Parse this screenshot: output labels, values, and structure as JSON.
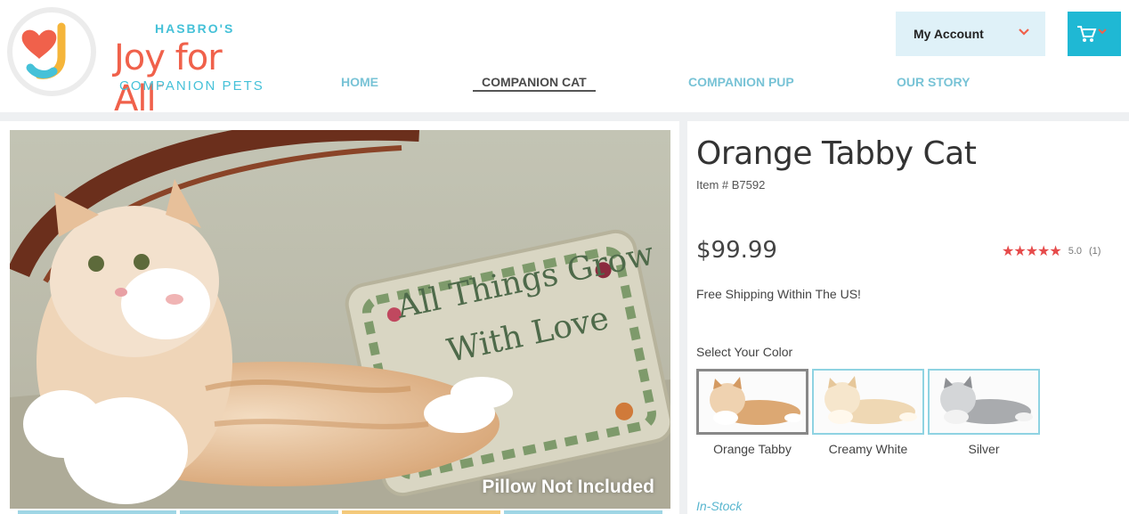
{
  "brand": {
    "top": "HASBRO'S",
    "name": "Joy for All",
    "tm": "™",
    "sub": "COMPANION PETS",
    "primary_color": "#f0614b",
    "accent_color": "#45c1d8"
  },
  "nav": {
    "items": [
      {
        "label": "HOME",
        "active": false
      },
      {
        "label": "COMPANION CAT",
        "active": true
      },
      {
        "label": "COMPANION PUP",
        "active": false
      },
      {
        "label": "OUR STORY",
        "active": false
      }
    ]
  },
  "account": {
    "label": "My Account",
    "icon": "chevron-down-icon"
  },
  "cart": {
    "icon": "cart-icon",
    "color": "#1fb8d4"
  },
  "product": {
    "image_caption": "Pillow Not Included",
    "pillow_text_1": "All Things Grow",
    "pillow_text_2": "With Love",
    "title": "Orange Tabby Cat",
    "item_number": "Item # B7592",
    "price": "$99.99",
    "rating": {
      "stars": "★★★★★",
      "value": "5.0",
      "count": "(1)",
      "star_color": "#e64b4b"
    },
    "shipping": "Free Shipping Within The US!",
    "color_label": "Select Your Color",
    "colors": [
      {
        "name": "Orange Tabby",
        "selected": true
      },
      {
        "name": "Creamy White",
        "selected": false
      },
      {
        "name": "Silver",
        "selected": false
      }
    ],
    "stock": "In-Stock"
  }
}
